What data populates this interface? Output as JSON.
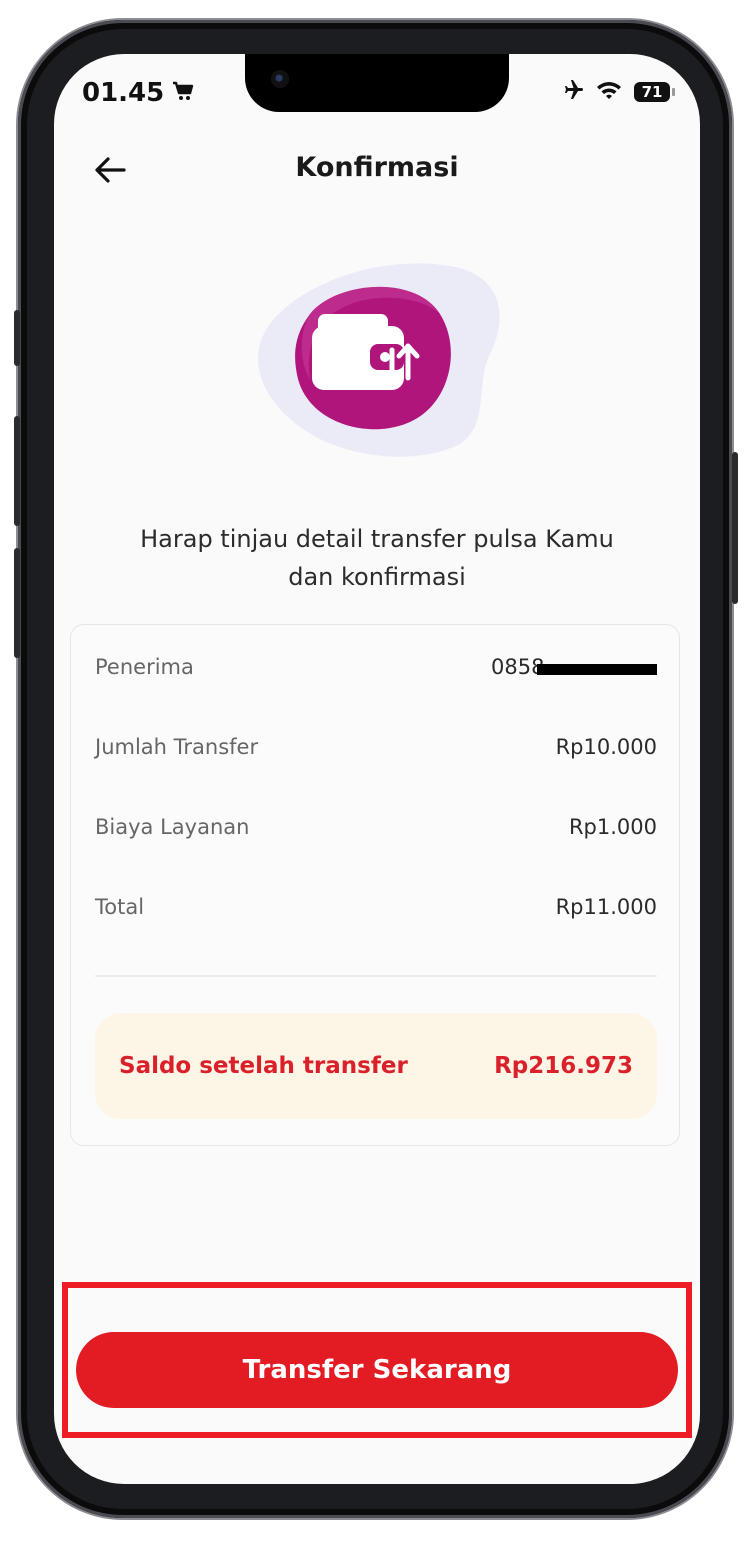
{
  "status_bar": {
    "time": "01.45",
    "battery": "71"
  },
  "header": {
    "title": "Konfirmasi"
  },
  "subtitle": {
    "line1": "Harap tinjau detail transfer pulsa Kamu",
    "line2": "dan konfirmasi"
  },
  "details": {
    "rows": [
      {
        "label": "Penerima",
        "value": "0858"
      },
      {
        "label": "Jumlah Transfer",
        "value": "Rp10.000"
      },
      {
        "label": "Biaya Layanan",
        "value": "Rp1.000"
      },
      {
        "label": "Total",
        "value": "Rp11.000"
      }
    ],
    "saldo_label": "Saldo setelah transfer",
    "saldo_value": "Rp216.973"
  },
  "actions": {
    "transfer_label": "Transfer Sekarang"
  },
  "colors": {
    "brand_red": "#e31b23",
    "accent_magenta": "#b0157c",
    "saldo_bg": "#fdf5e5"
  },
  "icons": [
    "cart-icon",
    "airplane-icon",
    "wifi-icon",
    "battery-icon",
    "back-arrow-icon",
    "wallet-transfer-icon"
  ]
}
